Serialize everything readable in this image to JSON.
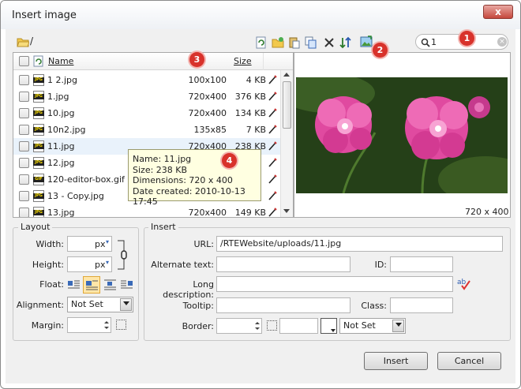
{
  "dialog": {
    "title": "Insert image",
    "close_label": "x"
  },
  "toolbar": {
    "open_folder_label": "/",
    "search": {
      "value": "1",
      "placeholder": ""
    }
  },
  "badges": [
    "1",
    "2",
    "3",
    "4"
  ],
  "filelist": {
    "headers": {
      "name": "Name",
      "size": "Size"
    },
    "rows": [
      {
        "name": "1 2.jpg",
        "dims": "100x100",
        "size": "4 KB",
        "type": "JPG"
      },
      {
        "name": "1.jpg",
        "dims": "720x400",
        "size": "376 KB",
        "type": "JPG"
      },
      {
        "name": "10.jpg",
        "dims": "720x400",
        "size": "134 KB",
        "type": "JPG"
      },
      {
        "name": "10n2.jpg",
        "dims": "135x85",
        "size": "7 KB",
        "type": "JPG"
      },
      {
        "name": "11.jpg",
        "dims": "720x400",
        "size": "238 KB",
        "type": "JPG"
      },
      {
        "name": "12.jpg",
        "dims": "",
        "size": "",
        "type": "JPG"
      },
      {
        "name": "120-editor-box.gif",
        "dims": "",
        "size": "",
        "type": "GIF"
      },
      {
        "name": "13 - Copy.jpg",
        "dims": "",
        "size": "",
        "type": "JPG"
      },
      {
        "name": "13.jpg",
        "dims": "720x400",
        "size": "149 KB",
        "type": "JPG"
      }
    ]
  },
  "tooltip": {
    "name": "Name: 11.jpg",
    "size": "Size: 238 KB",
    "dimensions": "Dimensions: 720 x 400",
    "created": "Date created: 2010-10-13 17:45"
  },
  "preview": {
    "caption": "720 x 400"
  },
  "layout": {
    "legend": "Layout",
    "width_label": "Width:",
    "height_label": "Height:",
    "unit": "px",
    "float_label": "Float:",
    "alignment_label": "Alignment:",
    "alignment_value": "Not Set",
    "margin_label": "Margin:"
  },
  "insert": {
    "legend": "Insert",
    "url_label": "URL:",
    "url_value": "/RTEWebsite/uploads/11.jpg",
    "alt_label": "Alternate text:",
    "id_label": "ID:",
    "longdesc_label": "Long description:",
    "tooltip_label": "Tooltip:",
    "class_label": "Class:",
    "border_label": "Border:",
    "border_style_value": "Not Set"
  },
  "buttons": {
    "insert": "Insert",
    "cancel": "Cancel"
  },
  "colors": {
    "badge": "#d8322b",
    "tooltip_bg": "#ffffe1",
    "close_red": "#c5473c"
  }
}
